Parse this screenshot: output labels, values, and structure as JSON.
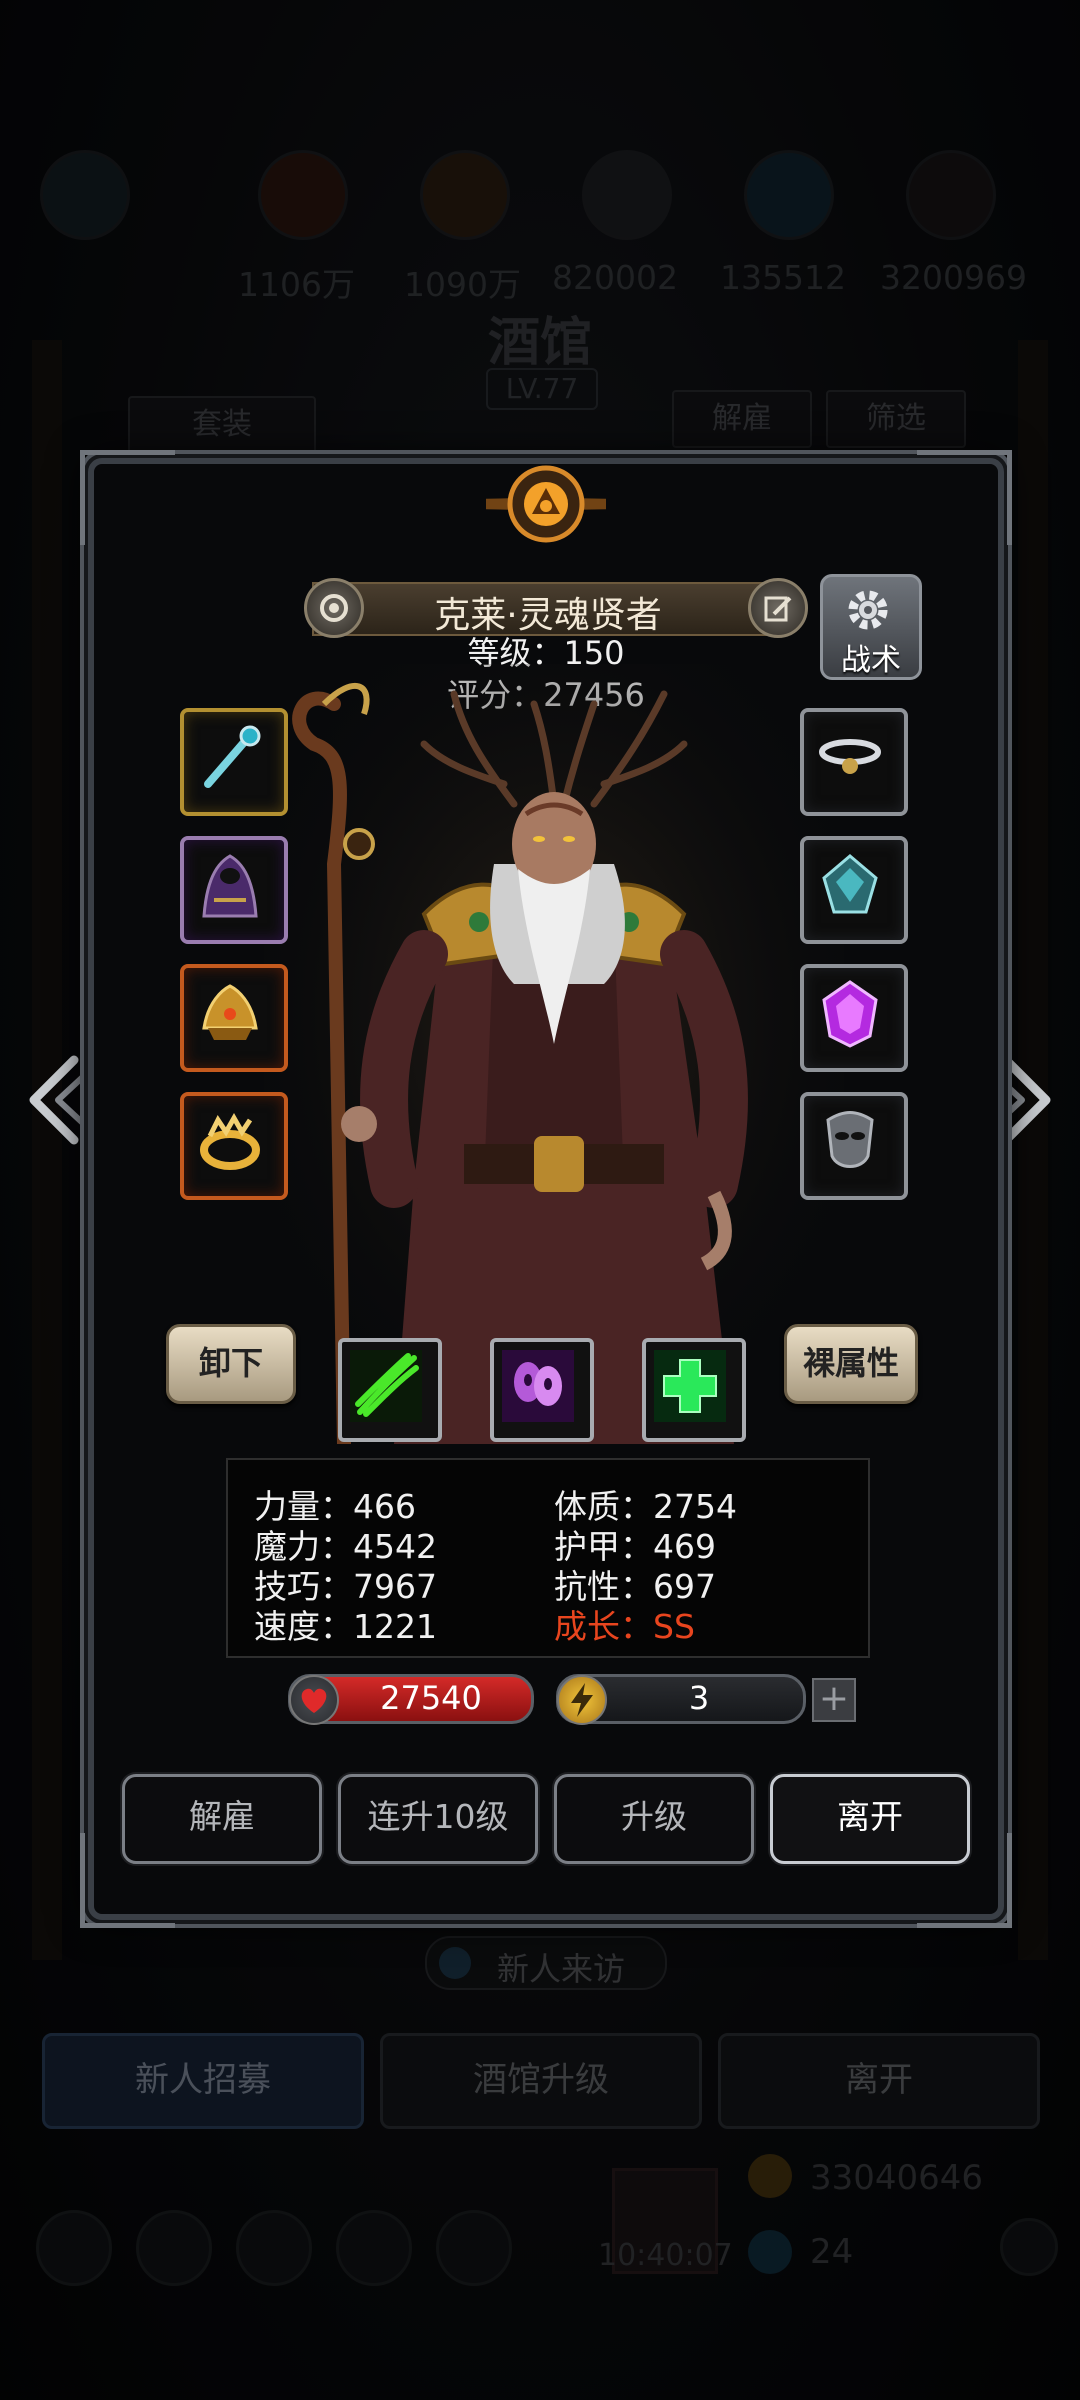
{
  "background": {
    "resources": [
      "1106万",
      "1090万",
      "820002",
      "135512",
      "3200969"
    ],
    "title": "酒馆",
    "level": "LV.77",
    "buttons": {
      "suit": "套装",
      "dismiss": "解雇",
      "filter": "筛选"
    },
    "visit_label": "新人来访",
    "bottom_buttons": [
      "新人招募",
      "酒馆升级",
      "离开"
    ],
    "gold": "33040646",
    "gems": "24",
    "clock": "10:40:07"
  },
  "hero": {
    "name": "克莱·灵魂贤者",
    "level_text": "等级：150",
    "score_text": "评分：27456",
    "tactic_label": "战术",
    "left_slots": [
      "staff-icon",
      "cloak-icon",
      "helmet-icon",
      "ring-icon"
    ],
    "right_slots": [
      "necklace-icon",
      "crystal-icon",
      "purple-gem-icon",
      "mask-icon"
    ],
    "skills": [
      "green-claw-icon",
      "purple-spirit-icon",
      "green-cross-icon"
    ],
    "unequip_label": "卸下",
    "base_attr_label": "裸属性"
  },
  "stats": {
    "strength": "力量：466",
    "magic": "魔力：4542",
    "skill": "技巧：7967",
    "speed": "速度：1221",
    "constitution": "体质：2754",
    "armor": "护甲：469",
    "resistance": "抗性：697",
    "growth": "成长：SS"
  },
  "bars": {
    "hp": "27540",
    "energy": "3",
    "plus": "+"
  },
  "actions": [
    "解雇",
    "连升10级",
    "升级",
    "离开"
  ],
  "colors": {
    "accent_gold": "#b39031",
    "growth_red": "#e8451e",
    "hp_red": "#d42a28"
  }
}
